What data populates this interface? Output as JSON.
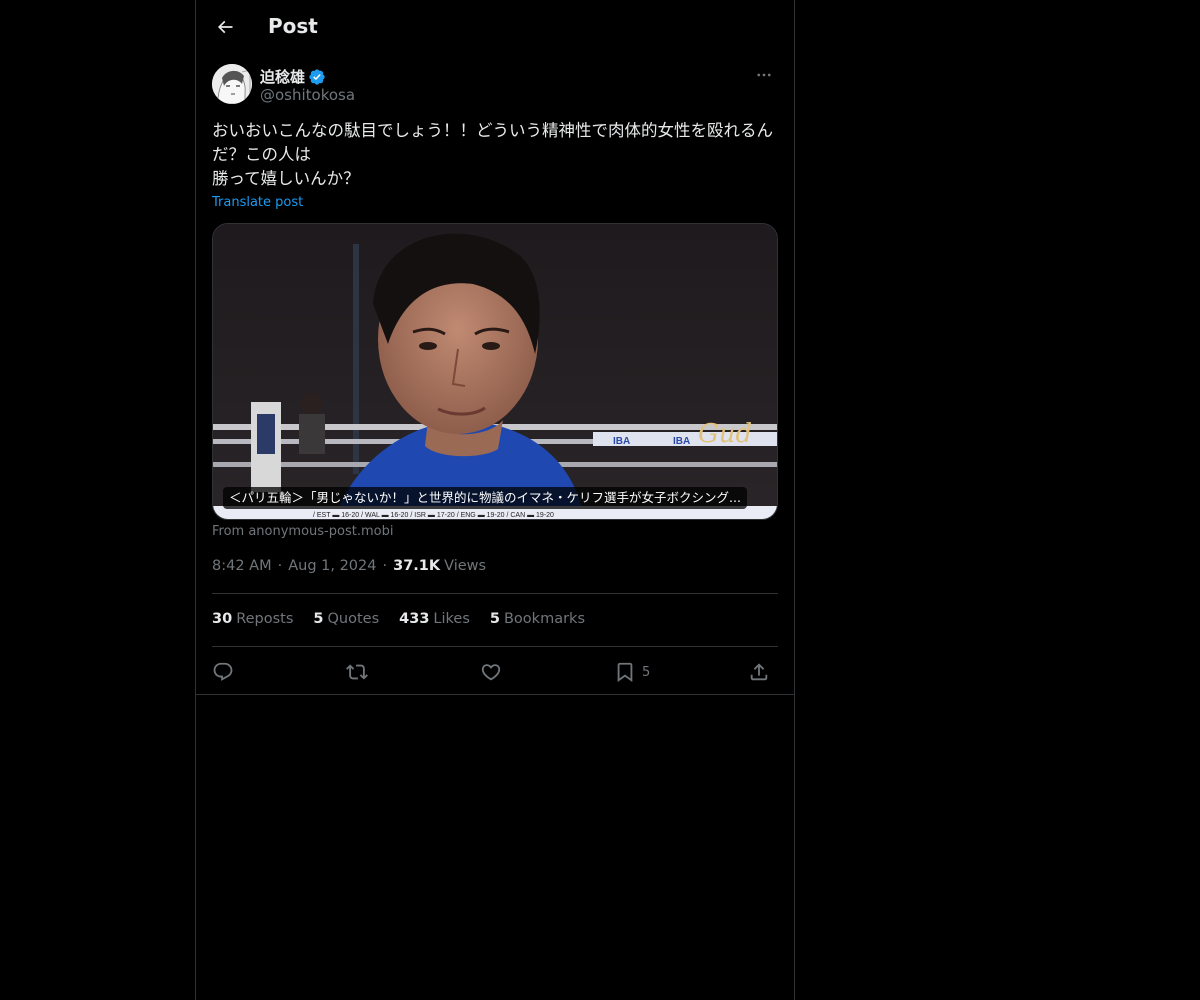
{
  "header": {
    "title": "Post"
  },
  "author": {
    "display_name": "迫稔雄",
    "handle": "@oshitokosa"
  },
  "post": {
    "text": "おいおいこんなの駄目でしょう！！どういう精神性で肉体的女性を殴れるんだ？この人は\n勝って嬉しいんか？",
    "translate_label": "Translate post",
    "media_caption": "＜パリ五輪＞「男じゃないか！」と世界的に物議のイマネ・ケリフ選手が女子ボクシング...",
    "source": "From anonymous-post.mobi"
  },
  "meta": {
    "time": "8:42 AM",
    "date": "Aug 1, 2024",
    "views_count": "37.1K",
    "views_label": "Views"
  },
  "stats": {
    "reposts_count": "30",
    "reposts_label": "Reposts",
    "quotes_count": "5",
    "quotes_label": "Quotes",
    "likes_count": "433",
    "likes_label": "Likes",
    "bookmarks_count": "5",
    "bookmarks_label": "Bookmarks"
  },
  "actions": {
    "bookmark_count": "5"
  },
  "icons": [
    "back-arrow-icon",
    "verified-badge-icon",
    "more-icon",
    "reply-icon",
    "repost-icon",
    "like-icon",
    "bookmark-icon",
    "share-icon"
  ],
  "colors": {
    "background": "#000000",
    "accent": "#1d9bf0",
    "border": "#2f3336",
    "muted": "#71767b",
    "text": "#e7e9ea"
  }
}
